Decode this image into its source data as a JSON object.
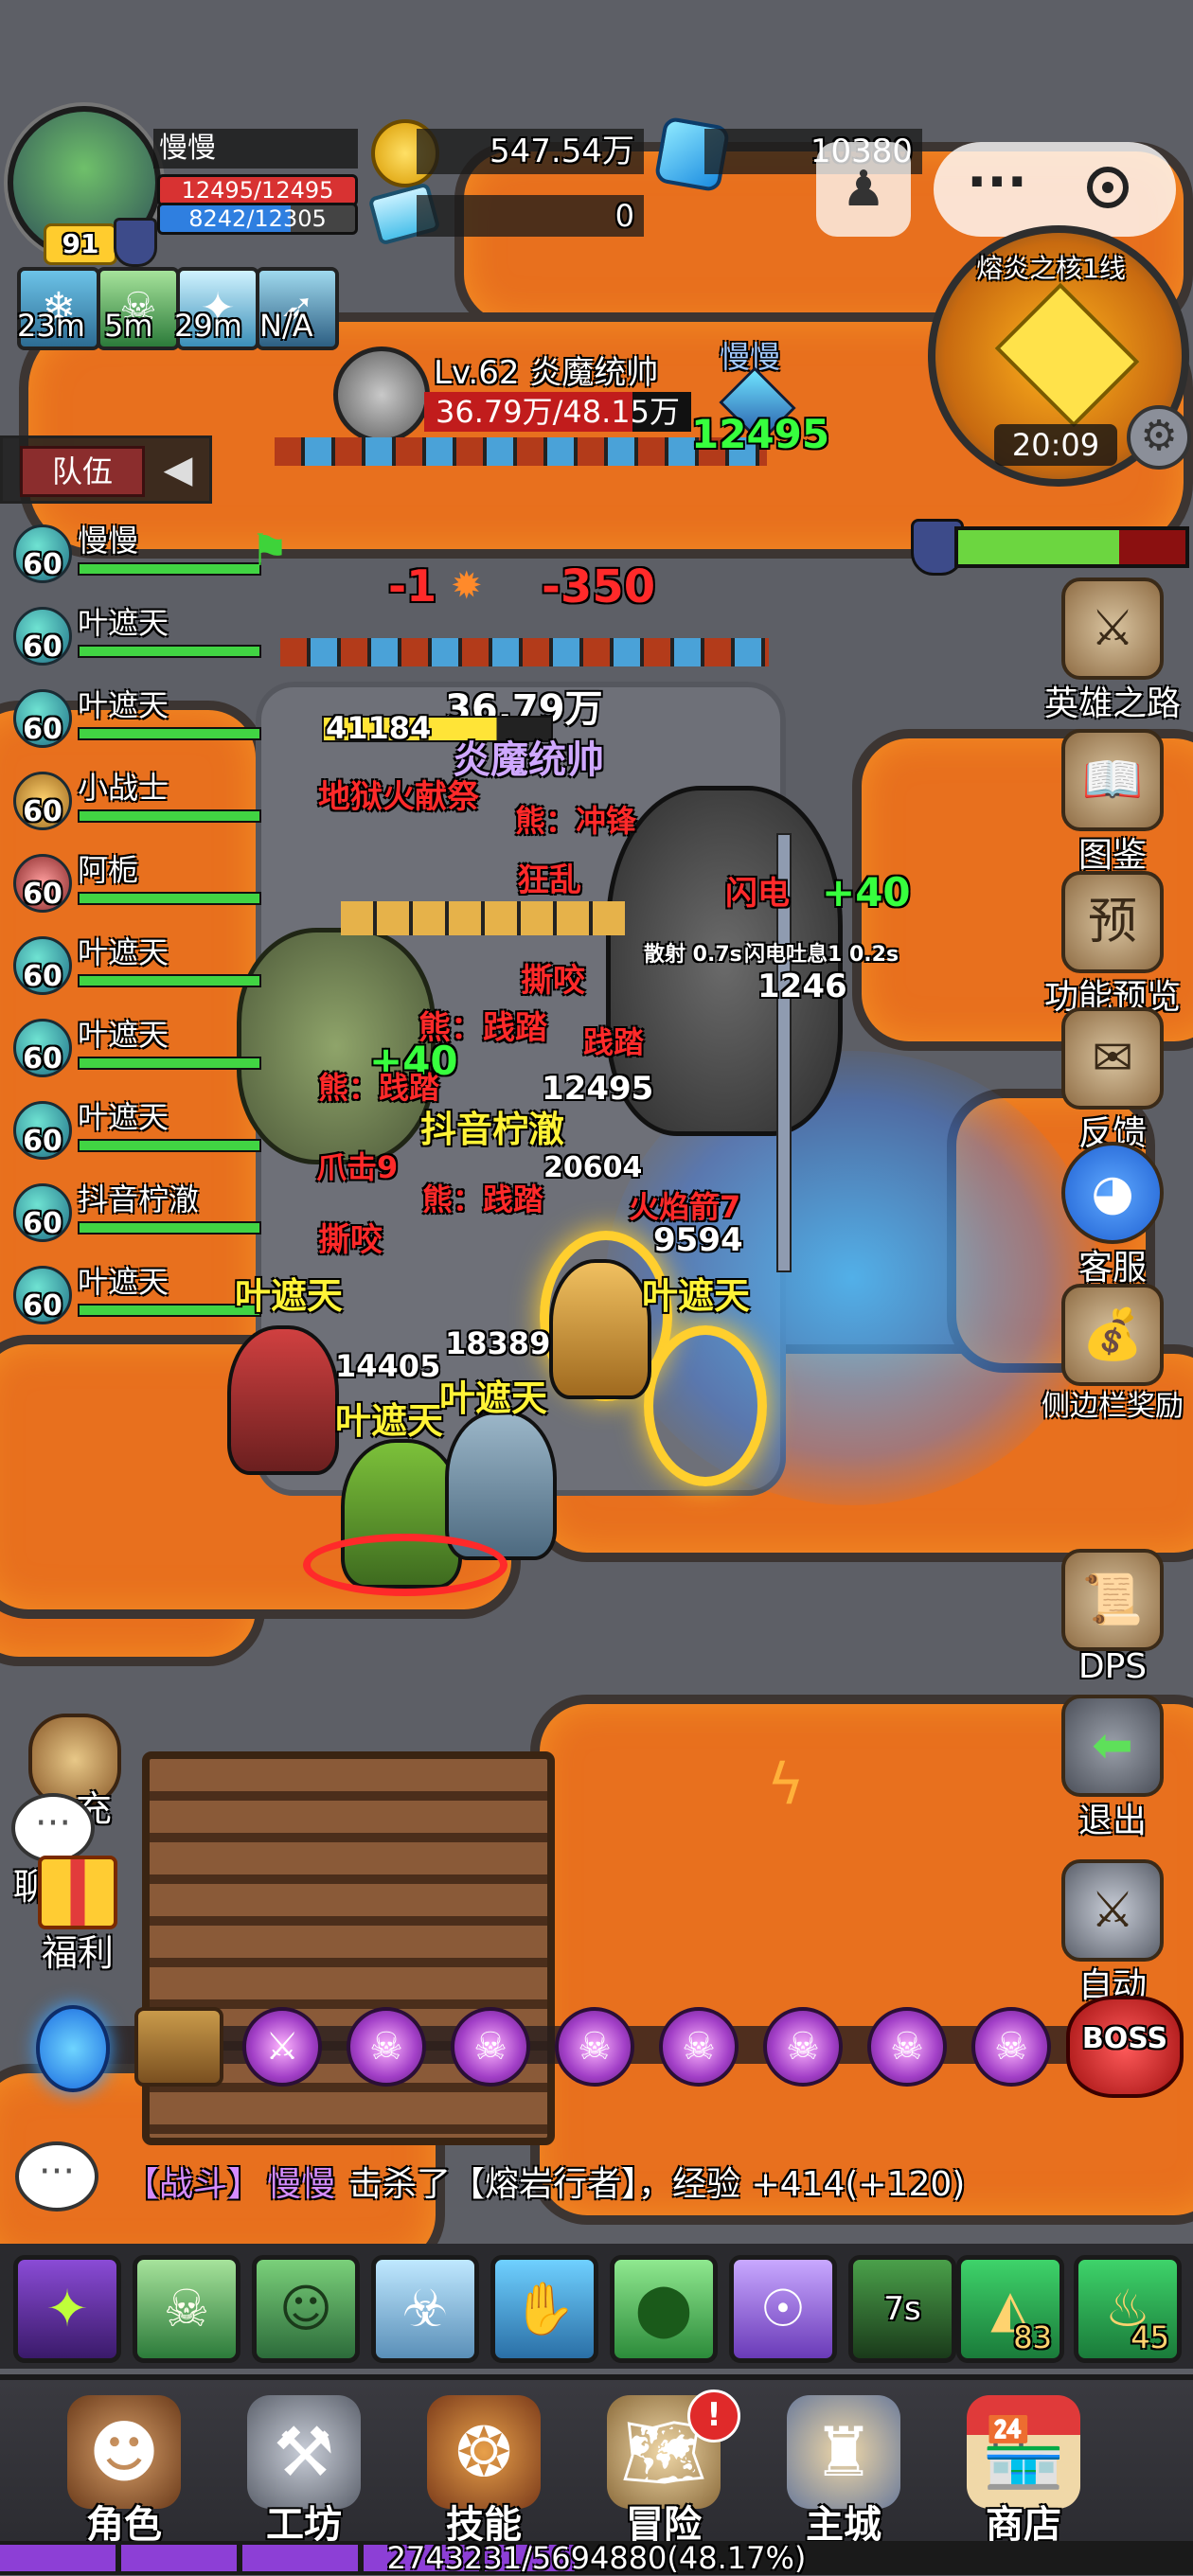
{
  "player": {
    "name": "慢慢",
    "level": "91",
    "hp": "12495/12495",
    "mp": "8242/12305",
    "hp_fraction": 1.0,
    "mp_fraction": 0.67
  },
  "currency": {
    "gold": "547.54万",
    "gems": "10380",
    "tickets": "0"
  },
  "buff_timers": [
    "23m",
    "5m",
    "29m",
    "N/A"
  ],
  "minimap": {
    "title": "熔炎之核1线",
    "time": "20:09"
  },
  "boss": {
    "title": "Lv.62 炎魔统帅",
    "hp": "36.79万/48.15万",
    "nameplate_hp": "36.79万",
    "nameplate_name": "炎魔统帅"
  },
  "team": {
    "tab_label": "队伍",
    "members": [
      {
        "level": "60",
        "name": "慢慢"
      },
      {
        "level": "60",
        "name": "叶遮天"
      },
      {
        "level": "60",
        "name": "叶遮天"
      },
      {
        "level": "60",
        "name": "小战士"
      },
      {
        "level": "60",
        "name": "阿栀"
      },
      {
        "level": "60",
        "name": "叶遮天"
      },
      {
        "level": "60",
        "name": "叶遮天"
      },
      {
        "level": "60",
        "name": "叶遮天"
      },
      {
        "level": "60",
        "name": "抖音柠澈"
      },
      {
        "level": "60",
        "name": "叶遮天"
      }
    ]
  },
  "hero_tag": {
    "name": "慢慢",
    "value": "12495"
  },
  "side_menu": [
    {
      "label": "英雄之路"
    },
    {
      "label": "图鉴"
    },
    {
      "label": "功能预览"
    },
    {
      "label": "反馈"
    },
    {
      "label": "客服"
    },
    {
      "label": "侧边栏奖励"
    },
    {
      "label": "DPS"
    },
    {
      "label": "退出"
    },
    {
      "label": "自动"
    }
  ],
  "left_menu": {
    "recharge": "充",
    "chat": "聊天",
    "welfare": "福利"
  },
  "combat_text": {
    "dmg1": "-1",
    "dmg2": "-350",
    "num_41184": "41184",
    "hell_sacrifice": "地狱火献祭",
    "bear_charge": "熊：冲锋",
    "frenzy": "狂乱",
    "lightning": "闪电",
    "heal40a": "+40",
    "num_1246": "1246",
    "tear1": "撕咬",
    "bear_stomp1": "熊：践踏",
    "stomp": "践踏",
    "heal40b": "+40",
    "bear_stomp2": "熊：践踏",
    "num_12495": "12495",
    "douyin": "抖音柠澈",
    "claw": "爪击9",
    "bear_stomp3": "熊：践踏",
    "fire_arrow": "火焰箭7",
    "tear2": "撕咬",
    "num_9594": "9594",
    "ye1": "叶遮天",
    "ye2": "叶遮天",
    "num_18389": "18389",
    "num_14405": "14405",
    "ye3": "叶遮天",
    "ye4": "叶遮天",
    "scatter": "散射 0.7s",
    "lightning_breath": "闪电吐息1 0.2s",
    "ye_hidden": "叶遮天",
    "num_20604": "20604"
  },
  "stage_bar": {
    "boss_label": "BOSS",
    "stage_count": 8
  },
  "chat_log": {
    "tag": "【战斗】",
    "name": "慢慢",
    "text": "击杀了【熔岩行者】，经验 +414(+120)"
  },
  "skill_bar": {
    "cooldown": "7s",
    "item1_count": "83",
    "item2_count": "45"
  },
  "nav": [
    {
      "label": "角色"
    },
    {
      "label": "工坊"
    },
    {
      "label": "技能"
    },
    {
      "label": "冒险"
    },
    {
      "label": "主城"
    },
    {
      "label": "商店"
    }
  ],
  "exp": {
    "text": "2743231/5694880(48.17%)",
    "fraction": 0.4817
  },
  "colors": {
    "lava": "#e8701e",
    "stone": "#6e7078",
    "hp": "#d83232",
    "mp": "#2f7fe0",
    "party_hp": "#41d443",
    "exp": "#8d3fd6"
  }
}
